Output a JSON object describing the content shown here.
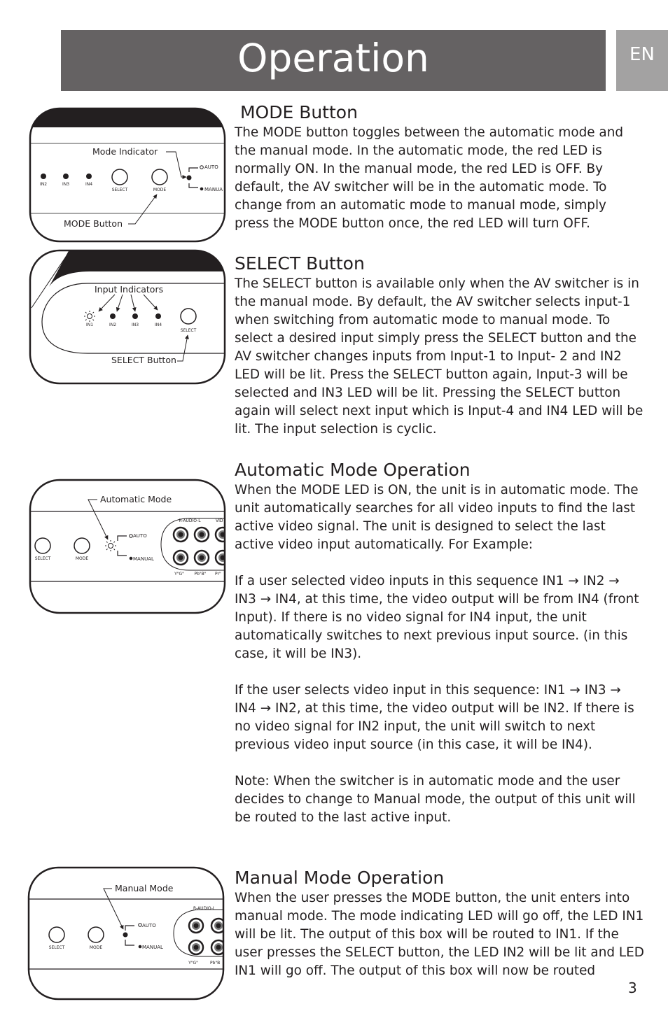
{
  "header": {
    "title": "Operation",
    "language_tab": "EN"
  },
  "colors": {
    "title_bar": "#656263",
    "language_tab": "#a3a2a2",
    "text": "#231f20"
  },
  "sections": [
    {
      "heading": " MODE Button",
      "paragraphs": [
        "The MODE button toggles between the automatic mode and the manual mode.  In the automatic mode,  the red LED is  normally ON.  In the manual mode, the red LED is OFF.  By default, the AV switcher  will be in the automatic mode.  To change from an automatic mode to manual mode, simply press the MODE button once, the red LED will turn OFF."
      ]
    },
    {
      "heading": "SELECT Button",
      "paragraphs": [
        "The SELECT button is available only when the AV switcher is in the manual mode.  By default, the AV switcher selects input-1 when switching from automatic mode to manual mode. To select a desired input simply press the SELECT button and the AV switcher changes inputs from Input-1 to Input- 2 and IN2 LED will be lit.  Press the SELECT button again, Input-3 will be selected and IN3 LED will be lit.  Pressing the SELECT button again will select next input which is Input-4 and IN4 LED will be lit. The input selection is cyclic."
      ]
    },
    {
      "heading": "Automatic Mode Operation",
      "paragraphs": [
        "When the MODE LED is ON, the unit is in automatic mode. The unit automatically searches for all video inputs to find the last active video signal.  The unit is designed to select the last active video input automatically. For Example:",
        "If a user selected video inputs in this sequence IN1 → IN2 → IN3 → IN4, at this time, the video output will be from IN4 (front Input).  If there is no video signal for IN4 input, the unit automatically switches to next previous input source. (in this case, it will be IN3).",
        "If the user selects video input in this sequence: IN1 → IN3 → IN4 → IN2, at this time, the video output will be IN2.  If there is no video signal for IN2 input, the unit will switch to next previous video input source (in this case, it will be IN4).",
        "Note:  When the switcher is in automatic mode and the user decides to change to Manual mode, the output of this unit will be routed to the last active input."
      ]
    },
    {
      "heading": "Manual Mode Operation",
      "paragraphs": [
        "When the user presses the MODE button, the unit enters into manual mode.  The mode indicating LED will go off, the LED IN1 will be lit.  The output of this box will be routed to IN1.  If the user presses the SELECT button, the LED IN2 will be lit and LED IN1 will go off.  The output of this box will now be routed"
      ]
    }
  ],
  "figures": {
    "mode_button": {
      "callout_top": "Mode Indicator",
      "callout_bottom": "MODE Button",
      "leds": [
        "IN2",
        "IN3",
        "IN4"
      ],
      "buttons": [
        "SELECT",
        "MODE"
      ],
      "auto_label": "AUTO",
      "manual_label": "MANUA"
    },
    "select_button": {
      "callout_top": "Input Indicators",
      "callout_bottom": "SELECT Button",
      "leds": [
        "IN1",
        "IN2",
        "IN3",
        "IN4"
      ],
      "button": "SELECT"
    },
    "automatic_mode": {
      "callout": "Automatic Mode",
      "buttons": [
        "SELECT",
        "MODE"
      ],
      "auto_label": "AUTO",
      "manual_label": "MANUAL",
      "jack_header": "R-AUDIO-L",
      "jack_header_2": "VID",
      "jack_labels": [
        "Y\"G\"",
        "Pb\"B\"",
        "Pr\""
      ]
    },
    "manual_mode": {
      "callout": "Manual Mode",
      "buttons": [
        "SELECT",
        "MODE"
      ],
      "auto_label": "AUTO",
      "manual_label": "MANUAL",
      "jack_header": "R-AUDIO-L",
      "jack_labels": [
        "Y\"G\"",
        "Pb\"B"
      ]
    }
  },
  "footer": {
    "page_number": "3"
  }
}
